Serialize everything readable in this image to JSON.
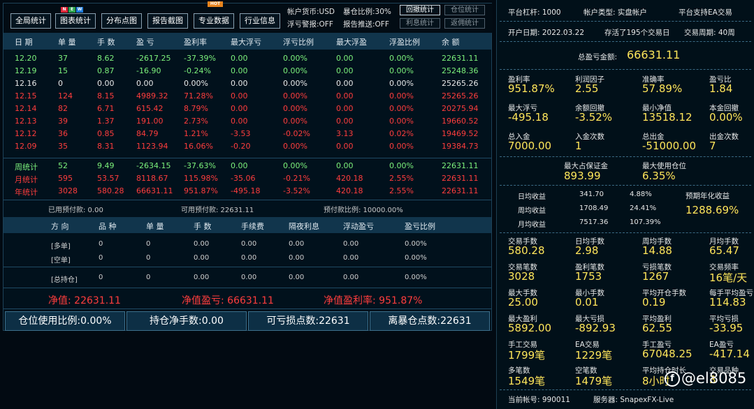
{
  "toolbar": {
    "buttons": [
      "全局统计",
      "图表统计",
      "分布点图",
      "报告截图",
      "专业数据",
      "行业信息"
    ],
    "new_badge": [
      "N",
      "E",
      "W"
    ],
    "hot_badge": "HOT",
    "account_currency": "帐户货币:USD",
    "burst_ratio": "暴仓比例:30%",
    "float_warn": "浮亏警报:OFF",
    "report_push": "报告推送:OFF",
    "small_buttons": [
      "回撤统计",
      "仓位统计",
      "利息统计",
      "返佣统计"
    ]
  },
  "colors": {
    "profit": "#ff3d3d",
    "loss": "#7cf07c",
    "highlight": "#ffe55a",
    "header": "#11354c"
  },
  "table": {
    "headers": [
      "日 期",
      "单 量",
      "手 数",
      "盈 亏",
      "盈利率",
      "最大浮亏",
      "浮亏比例",
      "最大浮盈",
      "浮盈比例",
      "余 额"
    ],
    "rows": [
      {
        "c": "g",
        "v": [
          "12.20",
          "37",
          "8.62",
          "-2617.25",
          "-37.39%",
          "0.00",
          "0.00%",
          "0.00",
          "0.00%",
          "22631.11"
        ]
      },
      {
        "c": "g",
        "v": [
          "12.19",
          "15",
          "0.87",
          "-16.90",
          "-0.24%",
          "0.00",
          "0.00%",
          "0.00",
          "0.00%",
          "25248.36"
        ]
      },
      {
        "c": "w",
        "v": [
          "12.16",
          "0",
          "0.00",
          "0.00",
          "0.00%",
          "0.00",
          "0.00%",
          "0.00",
          "0.00%",
          "25265.26"
        ]
      },
      {
        "c": "r",
        "v": [
          "12.15",
          "124",
          "8.15",
          "4989.32",
          "71.28%",
          "0.00",
          "0.00%",
          "0.00",
          "0.00%",
          "25265.26"
        ]
      },
      {
        "c": "r",
        "v": [
          "12.14",
          "82",
          "6.71",
          "615.42",
          "8.79%",
          "0.00",
          "0.00%",
          "0.00",
          "0.00%",
          "20275.94"
        ]
      },
      {
        "c": "r",
        "v": [
          "12.13",
          "39",
          "1.37",
          "191.00",
          "2.73%",
          "0.00",
          "0.00%",
          "0.00",
          "0.00%",
          "19660.52"
        ]
      },
      {
        "c": "r",
        "v": [
          "12.12",
          "36",
          "0.85",
          "84.79",
          "1.21%",
          "-3.53",
          "-0.02%",
          "3.13",
          "0.02%",
          "19469.52"
        ]
      },
      {
        "c": "r",
        "v": [
          "12.09",
          "35",
          "8.31",
          "1123.94",
          "16.06%",
          "-0.20",
          "0.00%",
          "0.00",
          "0.00%",
          "19384.73"
        ]
      }
    ],
    "summary": [
      {
        "c": "g",
        "v": [
          "周统计",
          "52",
          "9.49",
          "-2634.15",
          "-37.63%",
          "0.00",
          "0.00%",
          "0.00",
          "0.00%",
          "22631.11"
        ]
      },
      {
        "c": "r",
        "v": [
          "月统计",
          "595",
          "53.57",
          "8118.67",
          "115.98%",
          "-35.06",
          "-0.21%",
          "420.18",
          "2.55%",
          "22631.11"
        ]
      },
      {
        "c": "r",
        "v": [
          "年统计",
          "3028",
          "580.28",
          "66631.11",
          "951.87%",
          "-495.18",
          "-3.52%",
          "420.18",
          "2.55%",
          "22631.11"
        ]
      }
    ]
  },
  "prepay": {
    "used": "已用预付款: 0.00",
    "available": "可用预付款: 22631.11",
    "ratio": "预付款比例: 10000.00%"
  },
  "positions": {
    "headers": [
      "方 向",
      "品 种",
      "单 量",
      "手 数",
      "手续费",
      "隔夜利息",
      "浮动盈亏",
      "盈亏比例"
    ],
    "rows": [
      [
        "[多单]",
        "0",
        "0",
        "0.00",
        "0.00",
        "0.00",
        "0.00",
        "0.00%"
      ],
      [
        "[空单]",
        "0",
        "0",
        "0.00",
        "0.00",
        "0.00",
        "0.00",
        "0.00%"
      ],
      [
        "[总持仓]",
        "0",
        "0",
        "0.00",
        "0.00",
        "0.00",
        "0.00",
        "0.00%"
      ]
    ]
  },
  "totals": {
    "net": "净值: 22631.11",
    "net_pl": "净值盈亏: 66631.11",
    "net_rate": "净值盈利率: 951.87%"
  },
  "bottom_buttons": [
    "仓位使用比例:0.00%",
    "持仓净手数:0.00",
    "可亏损点数:22631",
    "离暴仓点数:22631"
  ],
  "right": {
    "header1": [
      "平台杠杆: 1000",
      "帐户类型: 实盘帐户",
      "平台支持EA交易"
    ],
    "header2": [
      "开户日期: 2022.03.22",
      "存活了195个交易日",
      "交易周期: 40周"
    ],
    "total_label": "总盈亏金额:",
    "total_value": "66631.11",
    "grid1": [
      [
        [
          "盈利率",
          "951.87%"
        ],
        [
          "利润因子",
          "2.55"
        ],
        [
          "准确率",
          "57.89%"
        ],
        [
          "盈亏比",
          "1.84"
        ]
      ],
      [
        [
          "最大浮亏",
          "-495.18"
        ],
        [
          "余额回撤",
          "-3.52%"
        ],
        [
          "最小净值",
          "13518.12"
        ],
        [
          "本金回撤",
          "0.00%"
        ]
      ],
      [
        [
          "总入金",
          "7000.00"
        ],
        [
          "入金次数",
          "1"
        ],
        [
          "总出金",
          "-51000.00"
        ],
        [
          "出金次数",
          "7"
        ]
      ]
    ],
    "margin": [
      [
        "最大占保证金",
        "893.99"
      ],
      [
        "最大使用仓位",
        "6.35%"
      ]
    ],
    "daily": [
      [
        "日均收益",
        "341.70",
        "4.88%"
      ],
      [
        "周均收益",
        "1708.49",
        "24.41%"
      ],
      [
        "月均收益",
        "7517.36",
        "107.39%"
      ]
    ],
    "annual_label": "预期年化收益",
    "annual_value": "1288.69%",
    "grid2": [
      [
        [
          "交易手数",
          "580.28"
        ],
        [
          "日均手数",
          "2.98"
        ],
        [
          "周均手数",
          "14.88"
        ],
        [
          "月均手数",
          "65.47"
        ]
      ],
      [
        [
          "交易笔数",
          "3028"
        ],
        [
          "盈利笔数",
          "1753"
        ],
        [
          "亏损笔数",
          "1267"
        ],
        [
          "交易频率",
          "16笔/天"
        ]
      ],
      [
        [
          "最大手数",
          "25.00"
        ],
        [
          "最小手数",
          "0.01"
        ],
        [
          "平均开仓手数",
          "0.19"
        ],
        [
          "每手平均盈亏",
          "114.83"
        ]
      ],
      [
        [
          "最大盈利",
          "5892.00"
        ],
        [
          "最大亏损",
          "-892.93"
        ],
        [
          "平均盈利",
          "62.55"
        ],
        [
          "平均亏损",
          "-33.95"
        ]
      ],
      [
        [
          "手工交易",
          "1799笔"
        ],
        [
          "EA交易",
          "1229笔"
        ],
        [
          "手工盈亏",
          "67048.25"
        ],
        [
          "EA盈亏",
          "-417.14"
        ]
      ],
      [
        [
          "多笔数",
          "1549笔"
        ],
        [
          "空笔数",
          "1479笔"
        ],
        [
          "平均持仓时长",
          "8小时"
        ],
        [
          "交易品种",
          "3"
        ]
      ]
    ],
    "footer": [
      "当前帐号: 990011",
      "服务器: SnapexFX-Live"
    ],
    "watermark": "@el8085"
  }
}
